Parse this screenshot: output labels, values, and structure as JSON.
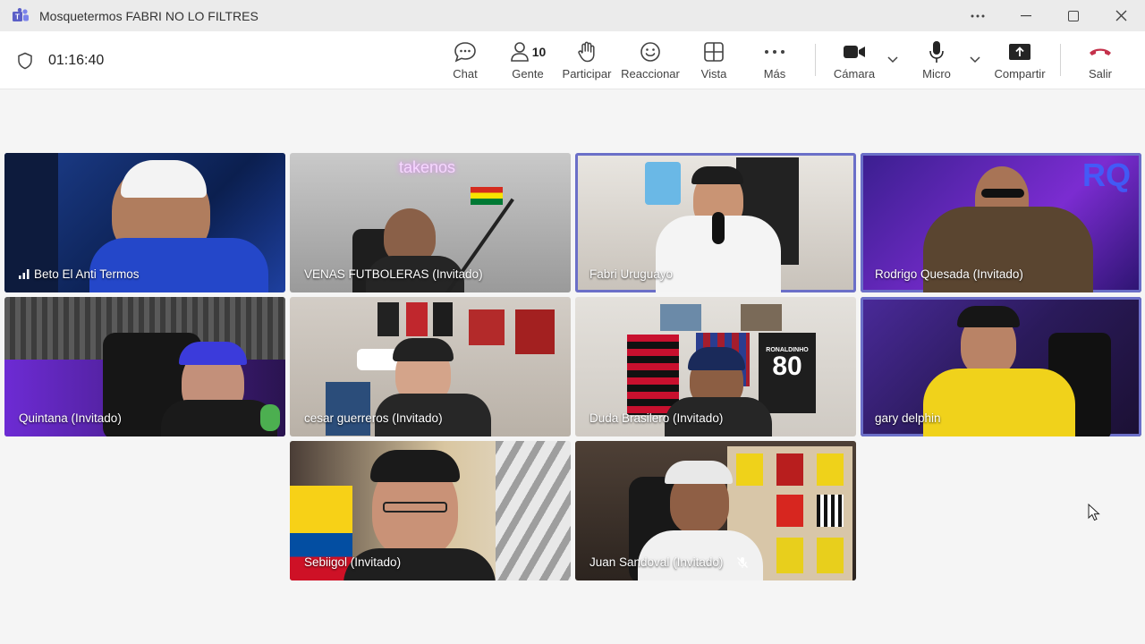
{
  "window": {
    "title": "Mosquetermos FABRI NO LO FILTRES"
  },
  "toolbar": {
    "timer": "01:16:40",
    "buttons": {
      "chat": "Chat",
      "people": "Gente",
      "people_count": "10",
      "raise": "Participar",
      "react": "Reaccionar",
      "view": "Vista",
      "more": "Más",
      "camera": "Cámara",
      "mic": "Micro",
      "share": "Compartir",
      "leave": "Salir"
    }
  },
  "participants": [
    {
      "name": "Beto El Anti Termos",
      "active": false
    },
    {
      "name": "VENAS FUTBOLERAS (Invitado)",
      "active": false
    },
    {
      "name": "Fabri Uruguayo",
      "active": true
    },
    {
      "name": "Rodrigo Quesada (Invitado)",
      "active": true
    },
    {
      "name": "Quintana (Invitado)",
      "active": false
    },
    {
      "name": "cesar guerreros (Invitado)",
      "active": false
    },
    {
      "name": "Duda Brasilero (Invitado)",
      "active": false
    },
    {
      "name": "gary delphin",
      "active": true
    },
    {
      "name": "Sebiigol (Invitado)",
      "active": false
    },
    {
      "name": "Juan Sandoval (Invitado)",
      "active": false,
      "muted": true
    }
  ],
  "scene_texts": {
    "neon_sign": "takenos",
    "rq_logo": "RQ",
    "jersey_number": "80",
    "jersey_name": "RONALDINHO"
  },
  "colors": {
    "accent": "#6b6fc8",
    "leave": "#c4314b"
  }
}
